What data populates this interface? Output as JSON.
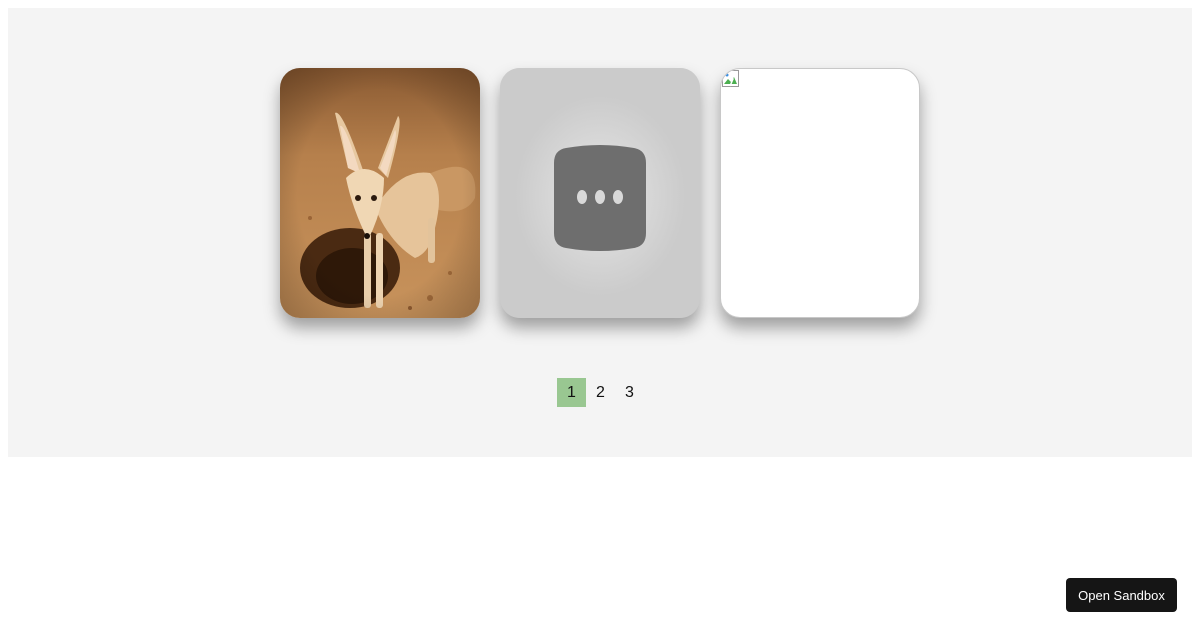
{
  "carousel": {
    "cards": [
      {
        "content": "fennec fox photo",
        "icon": "fox-image"
      },
      {
        "content": "loading placeholder",
        "icon": "ellipsis-icon"
      },
      {
        "content": "broken image",
        "icon": "broken-image-icon"
      }
    ]
  },
  "pagination": {
    "pages": [
      "1",
      "2",
      "3"
    ],
    "active_index": 0,
    "accent_color": "#99c791"
  },
  "sandbox_button": {
    "label": "Open Sandbox",
    "bg_color": "#151515"
  }
}
